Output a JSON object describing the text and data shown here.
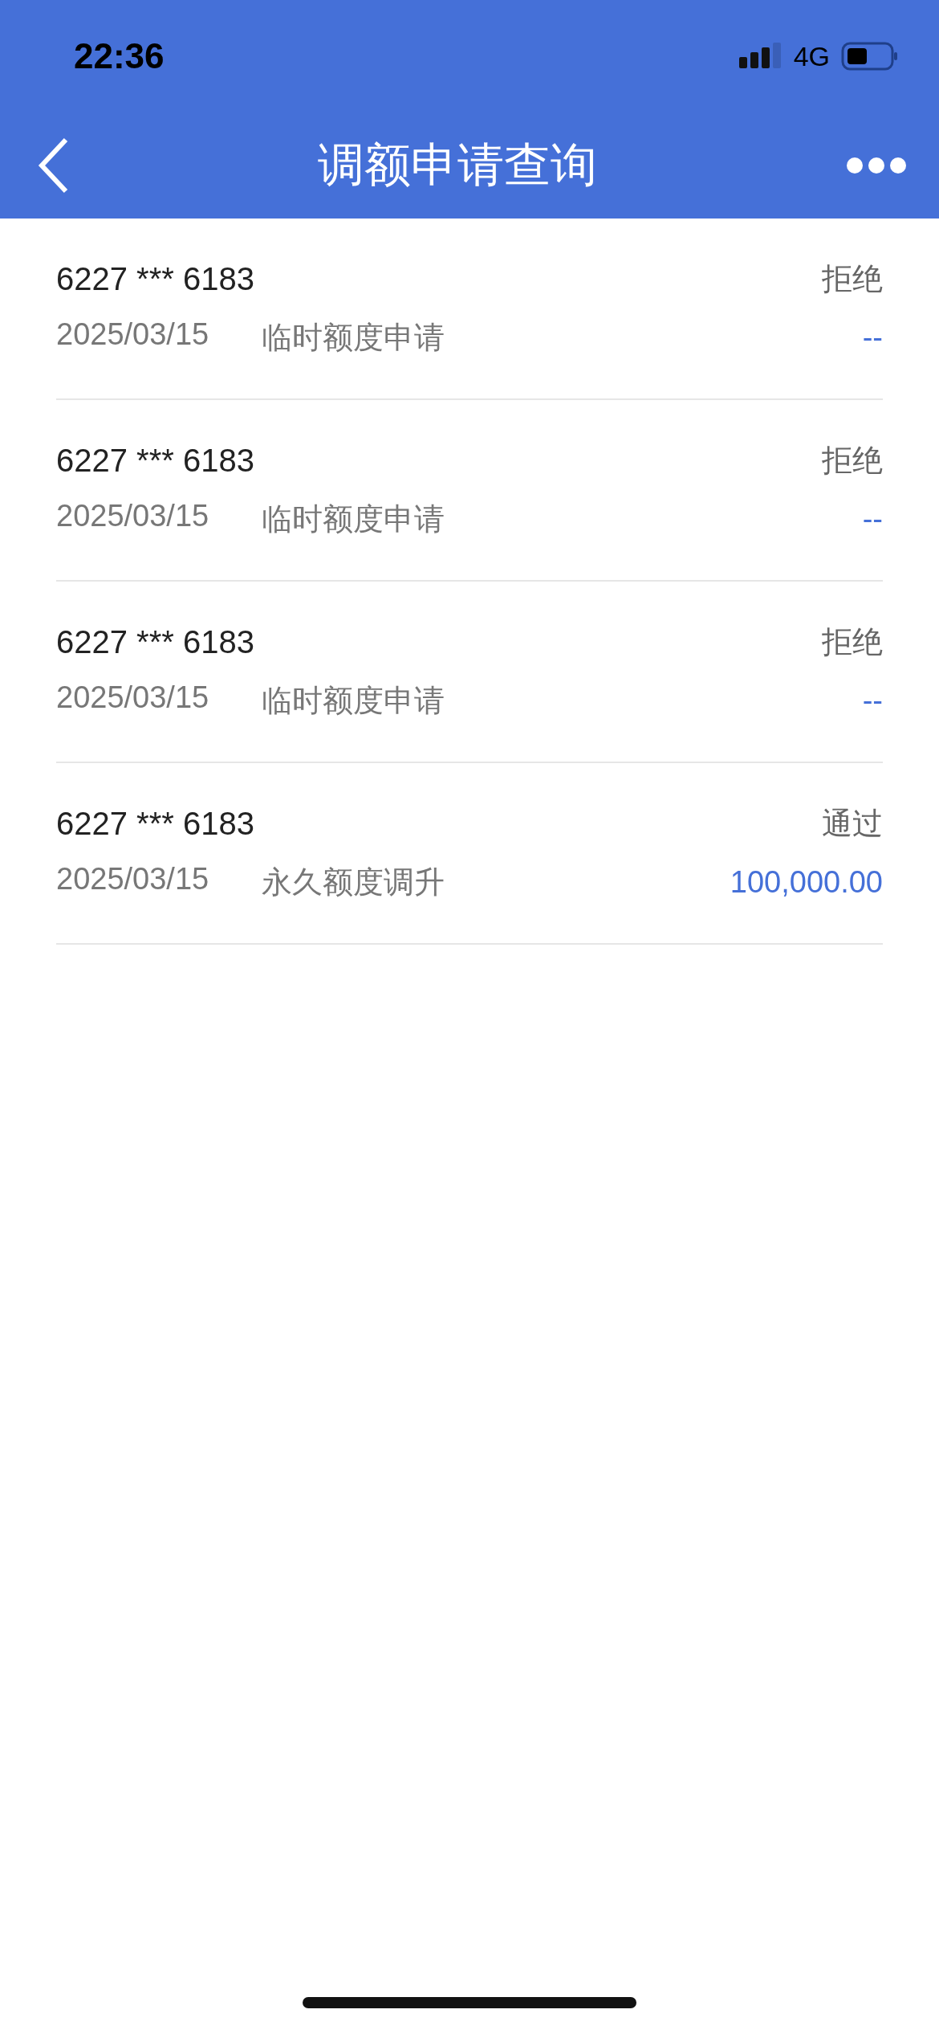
{
  "status_bar": {
    "time": "22:36",
    "network": "4G"
  },
  "nav": {
    "title": "调额申请查询"
  },
  "records": [
    {
      "card": "6227 *** 6183",
      "status": "拒绝",
      "date": "2025/03/15",
      "type": "临时额度申请",
      "amount": "--"
    },
    {
      "card": "6227 *** 6183",
      "status": "拒绝",
      "date": "2025/03/15",
      "type": "临时额度申请",
      "amount": "--"
    },
    {
      "card": "6227 *** 6183",
      "status": "拒绝",
      "date": "2025/03/15",
      "type": "临时额度申请",
      "amount": "--"
    },
    {
      "card": "6227 *** 6183",
      "status": "通过",
      "date": "2025/03/15",
      "type": "永久额度调升",
      "amount": "100,000.00"
    }
  ]
}
